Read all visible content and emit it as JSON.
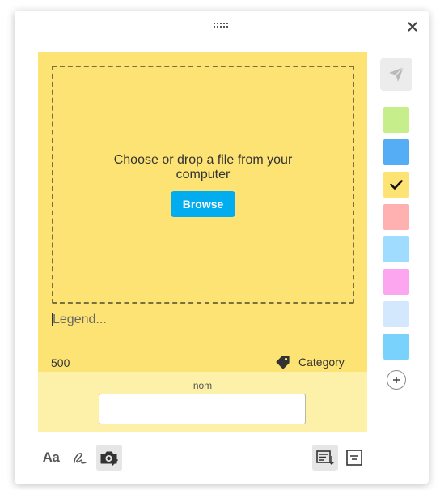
{
  "dropzone": {
    "message": "Choose or drop a file from your computer",
    "browse_label": "Browse"
  },
  "legend": {
    "placeholder": "Legend..."
  },
  "counter": "500",
  "category": {
    "label": "Category",
    "icon": "tag-icon"
  },
  "footer": {
    "name_label": "nom",
    "name_value": ""
  },
  "colors": {
    "note_background": "#fde374",
    "footer_background": "#fdf0a8",
    "browse_button": "#02adef",
    "swatches": [
      "#c6ef8c",
      "#55adf5",
      "#fde374",
      "#ffb0b0",
      "#9fdcff",
      "#fca6f0",
      "#d3e7fd",
      "#79d2fb"
    ],
    "selected_swatch": "#fde374"
  },
  "toolbar": {
    "tools": [
      "text-format-icon",
      "handwriting-icon",
      "camera-icon"
    ],
    "active_tool": "camera-icon",
    "right_tools": [
      "sort-list-icon",
      "note-lines-icon"
    ],
    "active_right_tool": "sort-list-icon"
  }
}
